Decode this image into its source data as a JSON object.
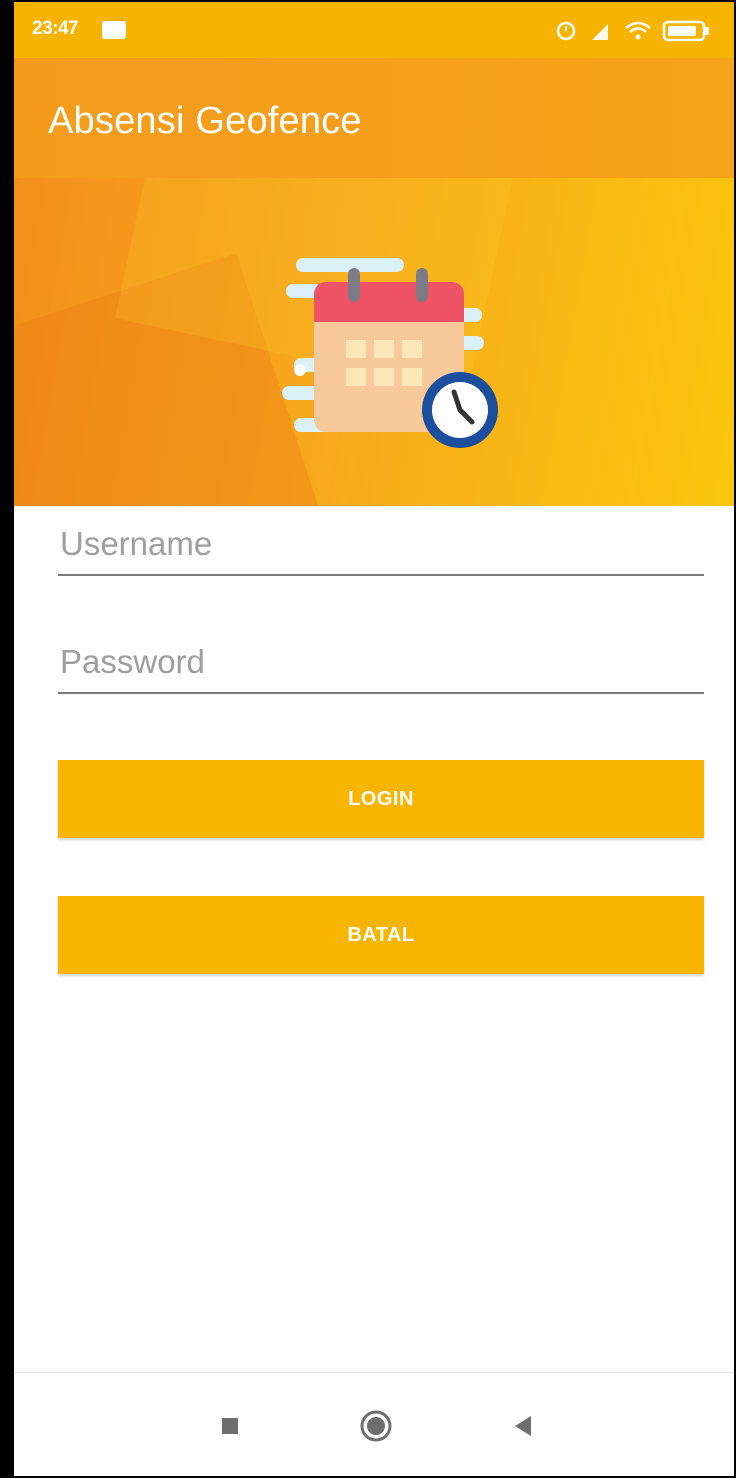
{
  "status_bar": {
    "time": "23:47",
    "icons": [
      "alarm-icon",
      "signal-icon",
      "wifi-icon",
      "battery-icon"
    ]
  },
  "app_bar": {
    "title": "Absensi Geofence"
  },
  "banner": {
    "illustration": "calendar-clock-icon"
  },
  "form": {
    "username_placeholder": "Username",
    "username_value": "",
    "password_placeholder": "Password",
    "password_value": ""
  },
  "buttons": {
    "login_label": "LOGIN",
    "cancel_label": "BATAL"
  },
  "nav_bar": {
    "icons": [
      "recents-square-icon",
      "home-circle-icon",
      "back-triangle-icon"
    ]
  },
  "colors": {
    "accent": "#F7B500",
    "app_bar": "#F49B1C",
    "banner_start": "#F48F1C",
    "banner_end": "#FBC70E"
  }
}
